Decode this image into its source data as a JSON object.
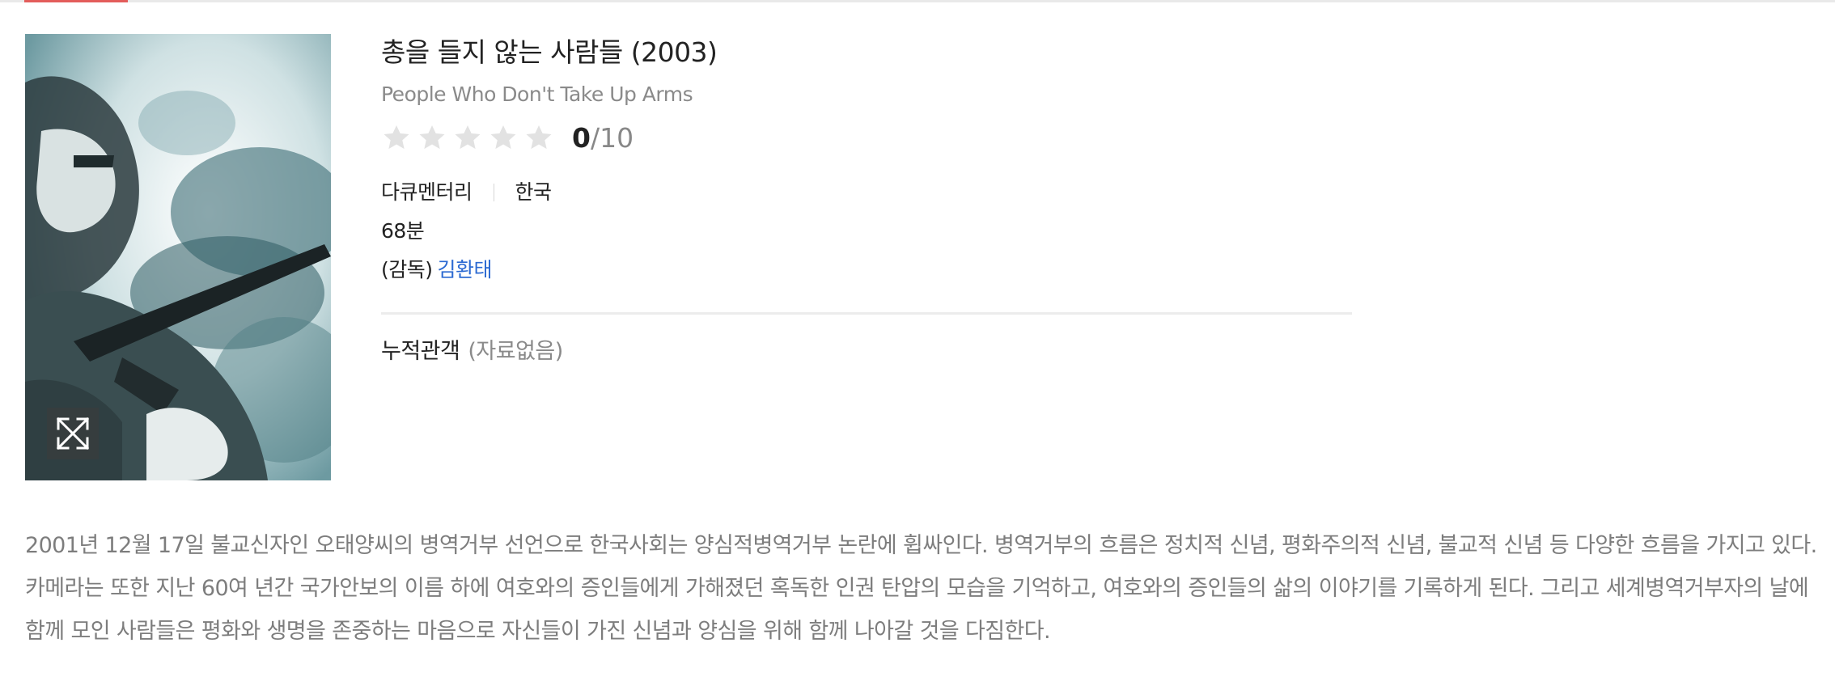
{
  "movie": {
    "title": "총을 들지 않는 사람들 (2003)",
    "original_title": "People Who Don't Take Up Arms",
    "rating": {
      "score": "0",
      "max": "/10",
      "stars_filled": 0,
      "stars_total": 5
    },
    "genre": "다큐멘터리",
    "country": "한국",
    "runtime": "68분",
    "director_label": "(감독)",
    "director_name": "김환태",
    "audience_label": "누적관객",
    "audience_value": "(자료없음)",
    "synopsis": "2001년 12월 17일 불교신자인 오태양씨의 병역거부 선언으로 한국사회는 양심적병역거부 논란에 휩싸인다. 병역거부의 흐름은 정치적 신념, 평화주의적 신념, 불교적 신념 등 다양한 흐름을 가지고 있다. 카메라는 또한 지난 60여 년간 국가안보의 이름 하에 여호와의 증인들에게 가해졌던 혹독한 인권 탄압의 모습을 기억하고, 여호와의 증인들의 삶의 이야기를 기록하게 된다. 그리고 세계병역거부자의 날에 함께 모인 사람들은 평화와 생명을 존중하는 마음으로 자신들이 가진 신념과 양심을 위해 함께 나아갈 것을 다짐한다."
  },
  "icons": {
    "star": "star-icon",
    "expand": "expand-icon"
  },
  "colors": {
    "accent": "#e35d5b",
    "link": "#2c6ad2",
    "star_empty": "#e2e2e2",
    "muted_text": "#8a8a8a"
  }
}
